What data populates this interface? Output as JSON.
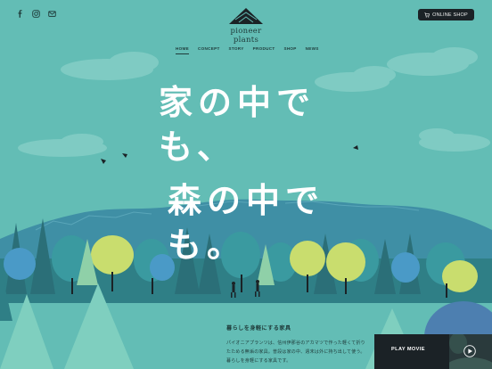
{
  "brand": {
    "name": "pioneer plants"
  },
  "header": {
    "social": [
      {
        "name": "facebook-icon"
      },
      {
        "name": "instagram-icon"
      },
      {
        "name": "mail-icon"
      }
    ],
    "shop_button": {
      "label": "ONLINE SHOP",
      "icon": "cart-icon"
    }
  },
  "nav": {
    "items": [
      {
        "label": "HOME",
        "active": true
      },
      {
        "label": "CONCEPT"
      },
      {
        "label": "STORY"
      },
      {
        "label": "PRODUCT"
      },
      {
        "label": "SHOP"
      },
      {
        "label": "NEWS"
      }
    ]
  },
  "hero": {
    "line1": "家の中でも、",
    "line2": "森の中でも。"
  },
  "intro": {
    "title": "暮らしを身軽にする家具",
    "body": "パイオニアプランツは、信州伊那谷のアカマツで作った軽くて折りたためる無垢の家具。普段は家の中、週末は外に持ち出して使う。暮らしを身軽にする家具です。"
  },
  "movie": {
    "label": "PLAY MOVIE",
    "icon": "play-icon"
  },
  "colors": {
    "sky": "#63bdb5",
    "mountain": "#3f8fa5",
    "forest_dark": "#2b6f78",
    "tree_yellow": "#c9dd6e",
    "dark": "#1b2226",
    "text": "#1f3b3a"
  }
}
